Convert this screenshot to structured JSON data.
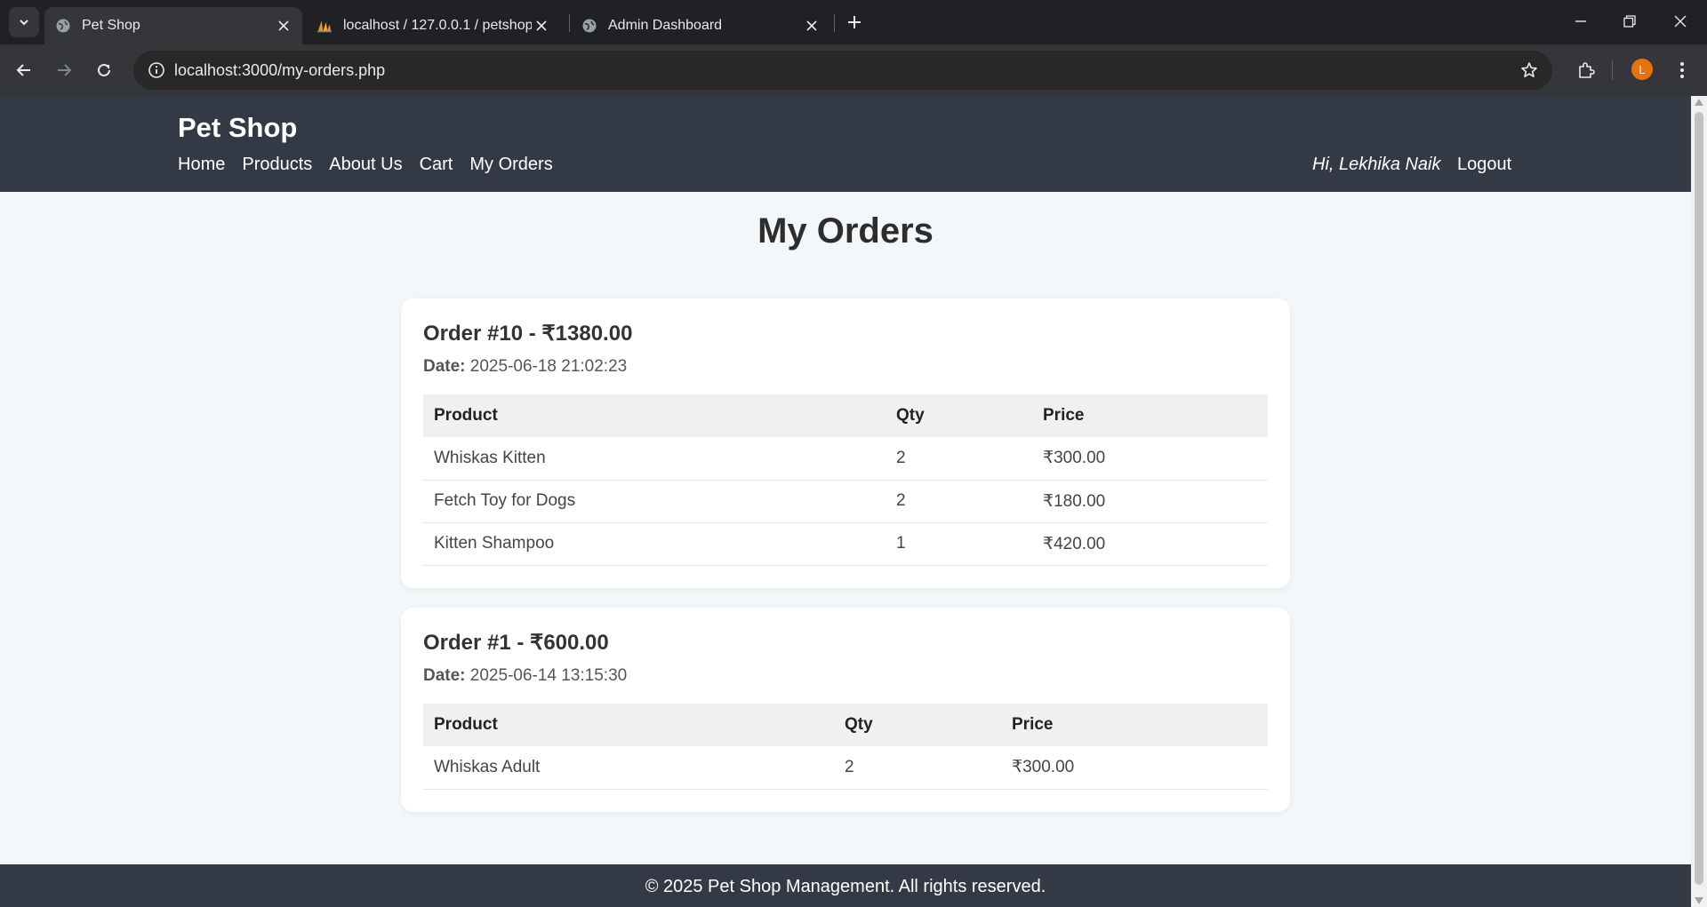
{
  "browser": {
    "tabs": [
      {
        "title": "Pet Shop",
        "active": true,
        "icon": "globe-icon"
      },
      {
        "title": "localhost / 127.0.0.1 / petshop / ...",
        "active": false,
        "icon": "phpmyadmin-icon"
      },
      {
        "title": "Admin Dashboard",
        "active": false,
        "icon": "globe-icon"
      }
    ],
    "url": "localhost:3000/my-orders.php",
    "profile_initial": "L",
    "accent": "#e8710a"
  },
  "site": {
    "brand": "Pet Shop",
    "nav": [
      "Home",
      "Products",
      "About Us",
      "Cart",
      "My Orders"
    ],
    "greeting": "Hi, Lekhika Naik",
    "logout": "Logout",
    "page_title": "My Orders",
    "footer": "© 2025 Pet Shop Management. All rights reserved."
  },
  "orders": [
    {
      "title": "Order #10 - ₹1380.00",
      "date_label": "Date:",
      "date": "2025-06-18 21:02:23",
      "columns": [
        "Product",
        "Qty",
        "Price"
      ],
      "items": [
        [
          "Whiskas Kitten",
          "2",
          "₹300.00"
        ],
        [
          "Fetch Toy for Dogs",
          "2",
          "₹180.00"
        ],
        [
          "Kitten Shampoo",
          "1",
          "₹420.00"
        ]
      ]
    },
    {
      "title": "Order #1 - ₹600.00",
      "date_label": "Date:",
      "date": "2025-06-14 13:15:30",
      "columns": [
        "Product",
        "Qty",
        "Price"
      ],
      "items": [
        [
          "Whiskas Adult",
          "2",
          "₹300.00"
        ]
      ]
    }
  ]
}
